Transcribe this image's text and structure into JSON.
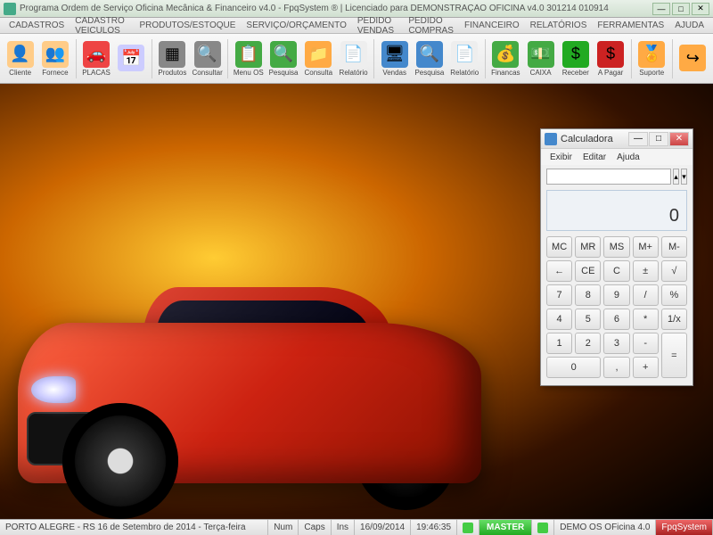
{
  "window": {
    "title": "Programa Ordem de Serviço Oficina Mecânica & Financeiro v4.0 - FpqSystem ® | Licenciado para DEMONSTRAÇÃO OFICINA v4.0 301214 010914"
  },
  "menubar": [
    "CADASTROS",
    "CADASTRO VEICULOS",
    "PRODUTOS/ESTOQUE",
    "SERVIÇO/ORÇAMENTO",
    "PEDIDO VENDAS",
    "PEDIDO COMPRAS",
    "FINANCEIRO",
    "RELATÓRIOS",
    "FERRAMENTAS",
    "AJUDA"
  ],
  "toolbar": [
    {
      "label": "Cliente",
      "icon": "👤",
      "bg": "#fc8"
    },
    {
      "label": "Fornece",
      "icon": "👥",
      "bg": "#fc8"
    },
    {
      "label": "PLACAS",
      "icon": "🚗",
      "bg": "#e44"
    },
    {
      "label": "",
      "icon": "📅",
      "bg": "#ccf"
    },
    {
      "label": "Produtos",
      "icon": "▦",
      "bg": "#888"
    },
    {
      "label": "Consultar",
      "icon": "🔍",
      "bg": "#888"
    },
    {
      "label": "Menu OS",
      "icon": "📋",
      "bg": "#4a4"
    },
    {
      "label": "Pesquisa",
      "icon": "🔍",
      "bg": "#4a4"
    },
    {
      "label": "Consulta",
      "icon": "📁",
      "bg": "#fa4"
    },
    {
      "label": "Relatório",
      "icon": "📄",
      "bg": "#eee"
    },
    {
      "label": "Vendas",
      "icon": "🖥",
      "bg": "#48c"
    },
    {
      "label": "Pesquisa",
      "icon": "🔍",
      "bg": "#48c"
    },
    {
      "label": "Relatório",
      "icon": "📄",
      "bg": "#eee"
    },
    {
      "label": "Financas",
      "icon": "💰",
      "bg": "#4a4"
    },
    {
      "label": "CAIXA",
      "icon": "💵",
      "bg": "#4a4"
    },
    {
      "label": "Receber",
      "icon": "$",
      "bg": "#2a2"
    },
    {
      "label": "A Pagar",
      "icon": "$",
      "bg": "#c22"
    },
    {
      "label": "Suporte",
      "icon": "🏅",
      "bg": "#fa4"
    },
    {
      "label": "",
      "icon": "↪",
      "bg": "#fa4"
    }
  ],
  "calculator": {
    "title": "Calculadora",
    "menu": [
      "Exibir",
      "Editar",
      "Ajuda"
    ],
    "display": "0",
    "input": "",
    "input_btn_up": "▴",
    "input_btn_down": "▾",
    "buttons": [
      [
        "MC",
        "MR",
        "MS",
        "M+",
        "M-"
      ],
      [
        "←",
        "CE",
        "C",
        "±",
        "√"
      ],
      [
        "7",
        "8",
        "9",
        "/",
        "%"
      ],
      [
        "4",
        "5",
        "6",
        "*",
        "1/x"
      ],
      [
        "1",
        "2",
        "3",
        "-",
        "="
      ],
      [
        "0",
        "0",
        ",",
        "+",
        "="
      ]
    ]
  },
  "statusbar": {
    "location": "PORTO ALEGRE - RS 16 de Setembro de 2014 - Terça-feira",
    "num": "Num",
    "caps": "Caps",
    "ins": "Ins",
    "date": "16/09/2014",
    "time": "19:46:35",
    "master": "MASTER",
    "demo": "DEMO OS OFicina 4.0",
    "brand": "FpqSystem"
  }
}
